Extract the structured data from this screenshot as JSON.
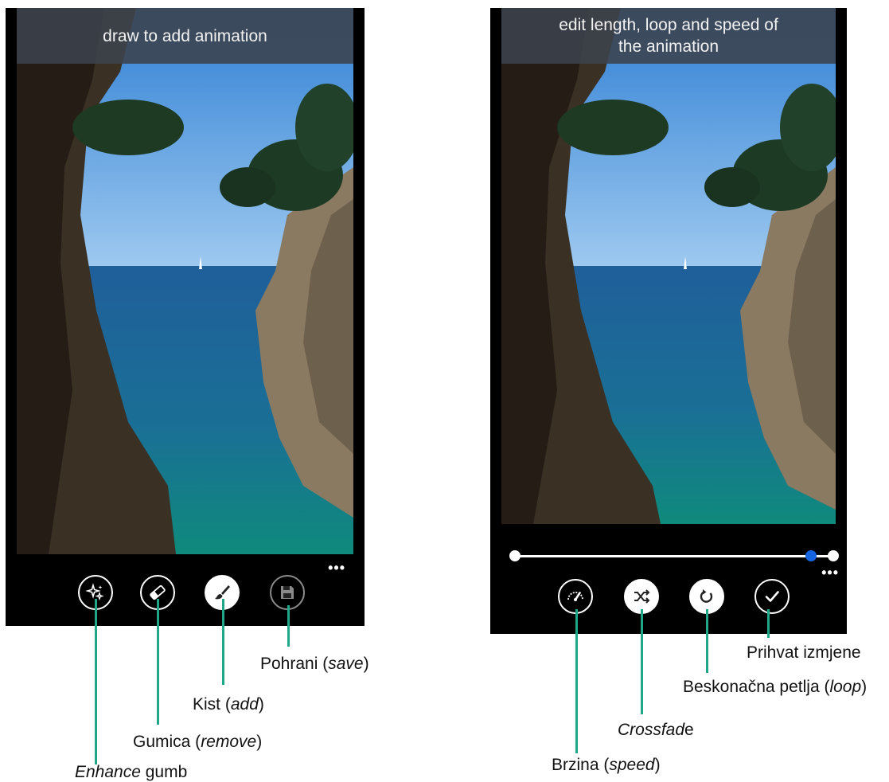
{
  "left_screen": {
    "banner_text": "draw to add animation",
    "more_label": "•••",
    "tools": [
      {
        "name": "enhance",
        "icon": "sparkle-icon"
      },
      {
        "name": "eraser",
        "icon": "eraser-icon"
      },
      {
        "name": "brush",
        "icon": "brush-icon"
      },
      {
        "name": "save",
        "icon": "floppy-disk-icon"
      }
    ]
  },
  "right_screen": {
    "banner_line1": "edit length, loop and speed of",
    "banner_line2": "the animation",
    "more_label": "•••",
    "slider": {
      "start": 0.0,
      "selected": 0.93,
      "end": 1.0
    },
    "tools": [
      {
        "name": "speed",
        "icon": "speedometer-icon"
      },
      {
        "name": "crossfade",
        "icon": "shuffle-icon"
      },
      {
        "name": "loop",
        "icon": "loop-icon"
      },
      {
        "name": "accept",
        "icon": "checkmark-icon"
      }
    ]
  },
  "annotations": {
    "enhance_italic": "Enhance",
    "enhance_rest": " gumb",
    "eraser_main": "Gumica (",
    "eraser_italic": "remove",
    "eraser_end": ")",
    "brush_main": "Kist (",
    "brush_italic": "add",
    "brush_end": ")",
    "save_main": "Pohrani (",
    "save_italic": "save",
    "save_end": ")",
    "speed_main": "Brzina (",
    "speed_italic": "speed",
    "speed_end": ")",
    "crossfade_italic": "Crossfad",
    "crossfade_rest": "e",
    "loop_main": "Beskonačna petlja (",
    "loop_italic": "loop",
    "loop_end": ")",
    "accept_text": "Prihvat izmjene"
  },
  "colors": {
    "leader_line": "#1fa888",
    "slider_active": "#1565e0",
    "banner_bg": "#3c424c"
  }
}
